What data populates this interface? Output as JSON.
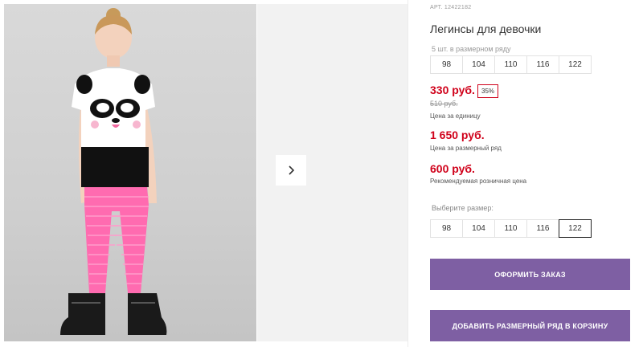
{
  "gallery": {
    "next_icon": "chevron-right-icon"
  },
  "product": {
    "article": "АРТ. 12422182",
    "title": "Легинсы для девочки"
  },
  "size_row": {
    "label": "5 шт. в размерном ряду",
    "sizes": [
      "98",
      "104",
      "110",
      "116",
      "122"
    ]
  },
  "prices": {
    "unit_price": "330 руб.",
    "discount": "35%",
    "old_price": "510 руб.",
    "unit_note": "Цена за единицу",
    "row_price": "1 650 руб.",
    "row_note": "Цена за размерный ряд",
    "retail_price": "600 руб.",
    "retail_note": "Рекомендуемая розничная цена"
  },
  "size_select": {
    "label": "Выберите размер:",
    "sizes": [
      "98",
      "104",
      "110",
      "116",
      "122"
    ],
    "selected": "122"
  },
  "buttons": {
    "order": "ОФОРМИТЬ ЗАКАЗ",
    "add_row": "ДОБАВИТЬ РАЗМЕРНЫЙ РЯД В КОРЗИНУ"
  },
  "colors": {
    "accent": "#7e5fa3",
    "price": "#d0021b"
  }
}
